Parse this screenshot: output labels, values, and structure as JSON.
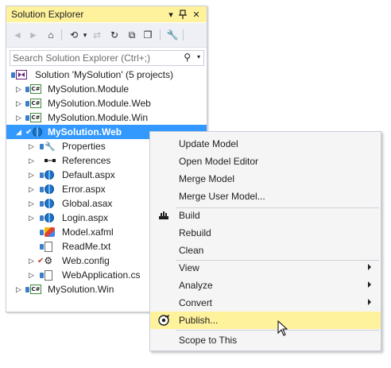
{
  "panel": {
    "title": "Solution Explorer",
    "title_icons": [
      "pin-dropdown-icon",
      "pin-icon",
      "close-icon"
    ],
    "search": {
      "placeholder": "Search Solution Explorer (Ctrl+;)"
    }
  },
  "toolbar": {
    "buttons": [
      "back-icon",
      "forward-icon",
      "home-icon",
      "history-icon",
      "sync-icon",
      "refresh-icon",
      "collapse-all-icon",
      "show-all-files-icon",
      "properties-wrench-icon"
    ]
  },
  "tree": {
    "solution": "Solution 'MySolution' (5 projects)",
    "projects": [
      "MySolution.Module",
      "MySolution.Module.Web",
      "MySolution.Module.Win",
      "MySolution.Web"
    ],
    "web_children": [
      "Properties",
      "References",
      "Default.aspx",
      "Error.aspx",
      "Global.asax",
      "Login.aspx",
      "Model.xafml",
      "ReadMe.txt",
      "Web.config",
      "WebApplication.cs"
    ],
    "last_project": "MySolution.Win",
    "selected": "MySolution.Web"
  },
  "context_menu": {
    "items": [
      {
        "label": "Update Model"
      },
      {
        "label": "Open Model Editor"
      },
      {
        "label": "Merge Model"
      },
      {
        "label": "Merge User Model..."
      },
      {
        "label": "Build",
        "icon": "build-icon"
      },
      {
        "label": "Rebuild"
      },
      {
        "label": "Clean"
      },
      {
        "label": "View",
        "submenu": true
      },
      {
        "label": "Analyze",
        "submenu": true
      },
      {
        "label": "Convert",
        "submenu": true
      },
      {
        "label": "Publish...",
        "icon": "publish-icon",
        "highlighted": true
      },
      {
        "label": "Scope to This"
      }
    ]
  },
  "colors": {
    "title_bar": "#fff29d",
    "selection": "#3399ff",
    "menu_highlight": "#fff29d",
    "menu_background": "#f5f5f5"
  }
}
